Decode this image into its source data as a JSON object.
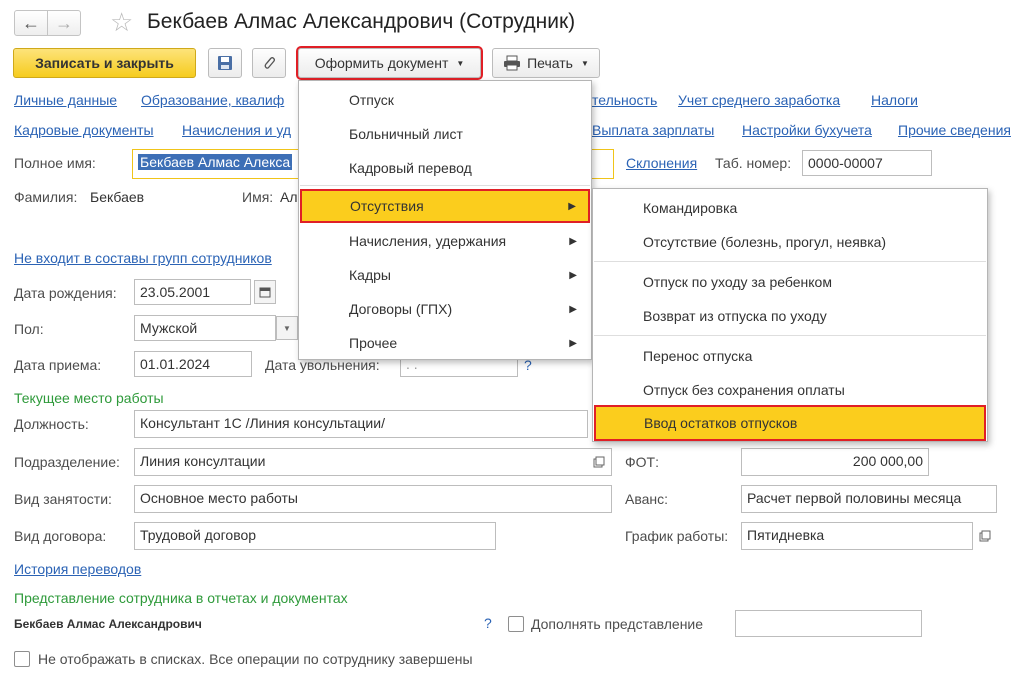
{
  "window": {
    "title": "Бекбаев Алмас Александрович (Сотрудник)"
  },
  "toolbar": {
    "save_close": "Записать и закрыть",
    "create_doc": "Оформить документ",
    "print": "Печать"
  },
  "links_row1": [
    "Личные данные",
    "Образование, квалиф",
    "тельность",
    "Учет среднего заработка",
    "Налоги"
  ],
  "links_row2": [
    "Кадровые документы",
    "Начисления и уд",
    "Выплата зарплаты",
    "Настройки бухучета",
    "Прочие сведения"
  ],
  "form": {
    "full_name_label": "Полное имя:",
    "full_name_value": "Бекбаев Алмас Алекса",
    "declension_link": "Склонения",
    "tab_num_label": "Таб. номер:",
    "tab_num_value": "0000-00007",
    "surname_label": "Фамилия:",
    "surname_value": "Бекбаев",
    "name_label": "Имя:",
    "name_value": "Ал",
    "groups_link": "Не входит в составы групп сотрудников",
    "birth_label": "Дата рождения:",
    "birth_value": "23.05.2001",
    "gender_label": "Пол:",
    "gender_value": "Мужской",
    "hire_label": "Дата приема:",
    "hire_value": "01.01.2024",
    "dismiss_label": "Дата увольнения:",
    "dismiss_value": ". .",
    "help_mark": "?",
    "workplace_header": "Текущее место работы",
    "position_label": "Должность:",
    "position_value": "Консультант 1С /Линия консультации/",
    "dept_label": "Подразделение:",
    "dept_value": "Линия консултации",
    "fot_label": "ФОТ:",
    "fot_value": "200 000,00",
    "employment_label": "Вид занятости:",
    "employment_value": "Основное место работы",
    "advance_label": "Аванс:",
    "advance_value": "Расчет первой половины месяца",
    "contract_label": "Вид договора:",
    "contract_value": "Трудовой договор",
    "schedule_label": "График работы:",
    "schedule_value": "Пятидневка",
    "history_link": "История переводов",
    "representation_header": "Представление сотрудника в отчетах и документах",
    "representation_value": "Бекбаев Алмас Александрович",
    "supplement_label": "Дополнять представление",
    "hide_label": "Не отображать в списках. Все операции по сотруднику завершены"
  },
  "menu": {
    "items": [
      "Отпуск",
      "Больничный лист",
      "Кадровый перевод",
      "Отсутствия",
      "Начисления, удержания",
      "Кадры",
      "Договоры (ГПХ)",
      "Прочее"
    ]
  },
  "submenu": {
    "items": [
      "Командировка",
      "Отсутствие (болезнь, прогул, неявка)",
      "Отпуск по уходу за ребенком",
      "Возврат из отпуска по уходу",
      "Перенос отпуска",
      "Отпуск без сохранения оплаты",
      "Ввод остатков отпусков"
    ]
  },
  "icons": [
    "back-arrow-icon",
    "forward-arrow-icon",
    "star-icon",
    "save-disk-icon",
    "paperclip-icon",
    "printer-icon",
    "calendar-icon",
    "open-form-icon",
    "chevron-right-icon"
  ],
  "colors": {
    "primary_button": "#fbd33a",
    "highlight": "#fbcd1d",
    "red_frame": "#e01f26",
    "link": "#2b63b5",
    "section_header": "#2e9a3a"
  }
}
